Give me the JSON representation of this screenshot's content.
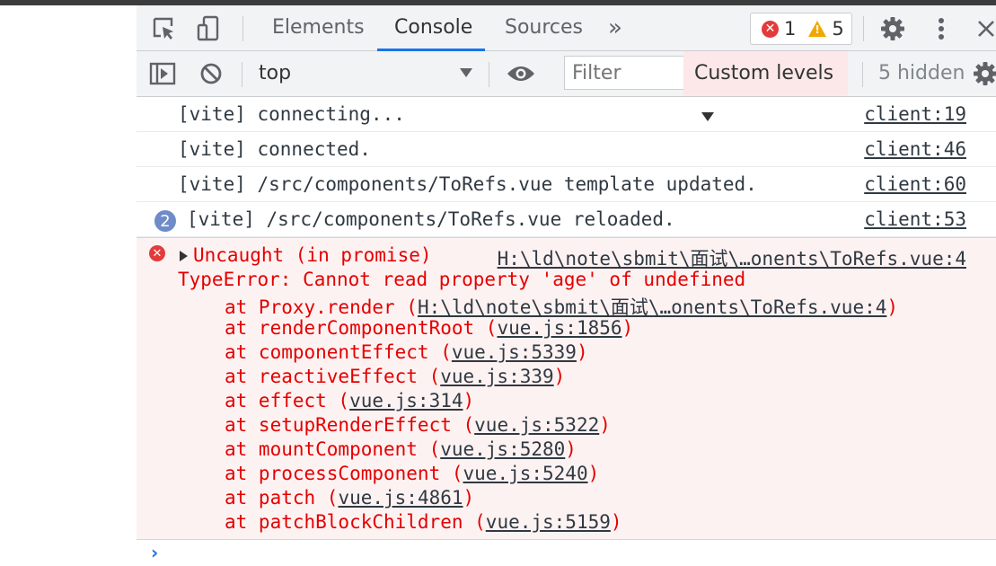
{
  "tabs": [
    {
      "label": "Elements"
    },
    {
      "label": "Console"
    },
    {
      "label": "Sources"
    }
  ],
  "more_tabs": "»",
  "issues": {
    "errors": "1",
    "warnings": "5"
  },
  "toolbar": {
    "context": "top",
    "filter_placeholder": "Filter",
    "levels": "Custom levels",
    "hidden": "5 hidden"
  },
  "messages": [
    {
      "text": "[vite] connecting...",
      "source": "client:19"
    },
    {
      "text": "[vite] connected.",
      "source": "client:46"
    },
    {
      "text": "[vite] /src/components/ToRefs.vue template updated.",
      "source": "client:60"
    },
    {
      "count": "2",
      "text": "[vite] /src/components/ToRefs.vue reloaded.",
      "source": "client:53"
    }
  ],
  "error": {
    "head": "Uncaught (in promise)",
    "source": "H:\\ld\\note\\sbmit\\面试\\…onents\\ToRefs.vue:4",
    "message": "TypeError: Cannot read property 'age' of undefined",
    "frames": [
      {
        "fn": "at Proxy.render (",
        "link": "H:\\ld\\note\\sbmit\\面试\\…onents\\ToRefs.vue:4",
        "close": ")"
      },
      {
        "fn": "at renderComponentRoot (",
        "link": "vue.js:1856",
        "close": ")"
      },
      {
        "fn": "at componentEffect (",
        "link": "vue.js:5339",
        "close": ")"
      },
      {
        "fn": "at reactiveEffect (",
        "link": "vue.js:339",
        "close": ")"
      },
      {
        "fn": "at effect (",
        "link": "vue.js:314",
        "close": ")"
      },
      {
        "fn": "at setupRenderEffect (",
        "link": "vue.js:5322",
        "close": ")"
      },
      {
        "fn": "at mountComponent (",
        "link": "vue.js:5280",
        "close": ")"
      },
      {
        "fn": "at processComponent (",
        "link": "vue.js:5240",
        "close": ")"
      },
      {
        "fn": "at patch (",
        "link": "vue.js:4861",
        "close": ")"
      },
      {
        "fn": "at patchBlockChildren (",
        "link": "vue.js:5159",
        "close": ")"
      }
    ]
  },
  "prompt": "›"
}
